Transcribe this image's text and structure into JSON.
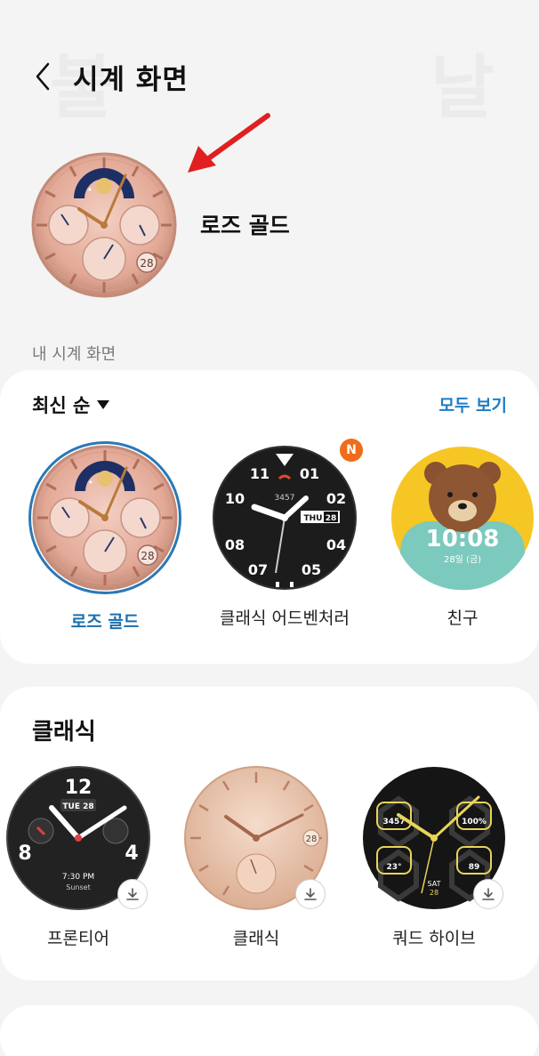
{
  "header": {
    "title": "시계 화면",
    "back_icon": "chevron-left-icon"
  },
  "background_glyphs": [
    "불",
    "날"
  ],
  "current_face": {
    "name": "로즈 골드",
    "date": "28"
  },
  "my_faces": {
    "section_label": "내 시계 화면",
    "sort_label": "최신 순",
    "see_all_label": "모두 보기",
    "items": [
      {
        "label": "로즈 골드",
        "selected": true,
        "date": "28"
      },
      {
        "label": "클래식 어드벤처러",
        "badge": "N",
        "day": "THU",
        "date": "28",
        "numbers": [
          "11",
          "01",
          "02",
          "04",
          "05",
          "07",
          "08",
          "10"
        ],
        "counter": "3457"
      },
      {
        "label": "친구",
        "time": "10:08",
        "date": "28일 (금)"
      }
    ]
  },
  "classic": {
    "title": "클래식",
    "items": [
      {
        "label": "프론티어",
        "day_date": "TUE 28",
        "numbers": [
          "12",
          "4",
          "8"
        ],
        "time": "7:30 PM",
        "sub": "Sunset"
      },
      {
        "label": "클래식",
        "date": "28"
      },
      {
        "label": "쿼드 하이브",
        "stats": [
          "3457",
          "100%",
          "23°",
          "89"
        ],
        "day": "SAT",
        "date": "28"
      }
    ]
  },
  "colors": {
    "accent": "#1f7dc4",
    "selected_ring": "#2b78b6",
    "badge": "#ef6c1a",
    "rose_gold": "#e6b3a3",
    "arrow": "#e02020"
  }
}
